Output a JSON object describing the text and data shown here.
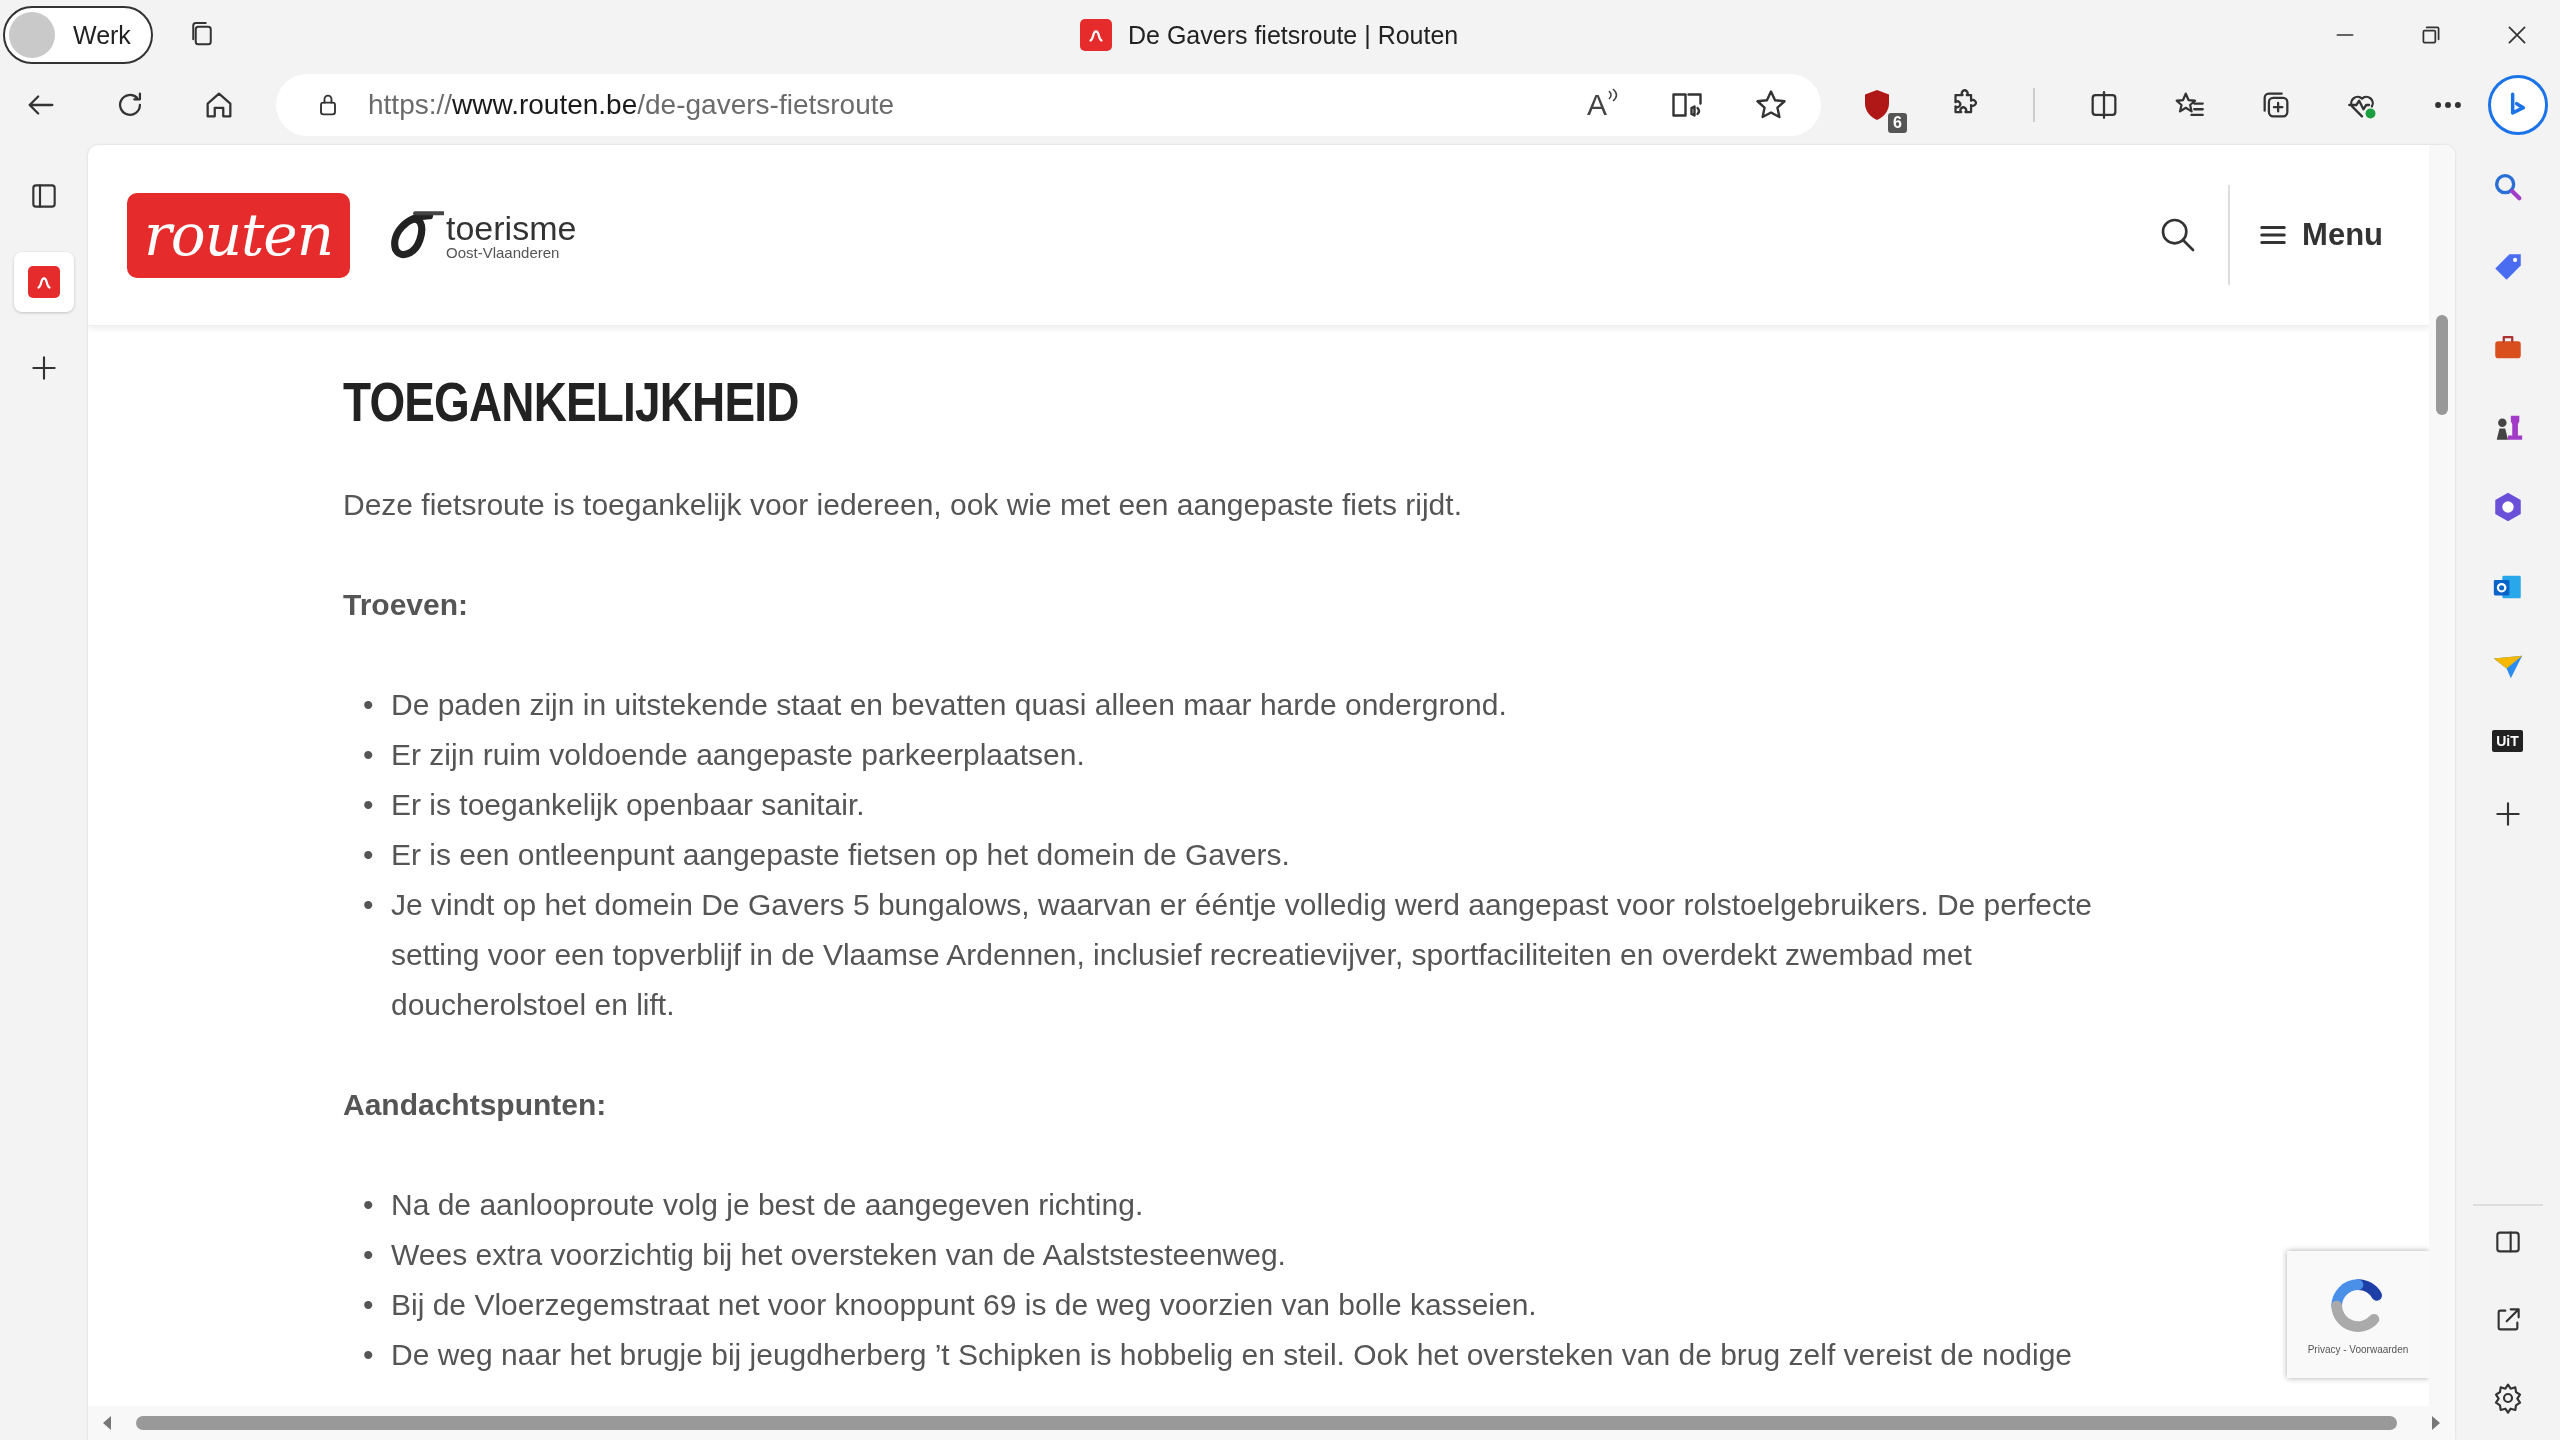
{
  "browser": {
    "profile": "Werk",
    "tab_title": "De Gavers fietsroute | Routen",
    "url": "https://**www.routen.be**/de-gavers-fietsroute",
    "read_aloud_glyph": "A",
    "extension_badge": "6",
    "sidebar_app_label": "UiT"
  },
  "header": {
    "logo": "routen",
    "partner_name": "toerisme",
    "partner_region": "Oost-Vlaanderen",
    "menu_label": "Menu"
  },
  "article": {
    "heading": "TOEGANKELIJKHEID",
    "intro": "Deze fietsroute is toegankelijk voor iedereen, ook wie met een aangepaste fiets rijdt.",
    "groups": [
      {
        "title": "Troeven:",
        "items": [
          {
            "marker": "•",
            "text": "De paden zijn in uitstekende staat en bevatten quasi alleen maar harde ondergrond."
          },
          {
            "marker": "•",
            "text": "Er zijn ruim voldoende aangepaste parkeerplaatsen."
          },
          {
            "marker": "•",
            "text": "Er is toegankelijk openbaar sanitair."
          },
          {
            "marker": "•",
            "text": "Er is een ontleenpunt aangepaste fietsen op het domein de Gavers."
          },
          {
            "marker": "•",
            "text": "Je vindt op het domein De Gavers 5 bungalows, waarvan er ééntje volledig werd aangepast voor rolstoelgebruikers. De perfecte setting voor een topverblijf in de Vlaamse Ardennen, inclusief recreatievijver, sportfaciliteiten en overdekt zwembad met doucherolstoel en lift."
          }
        ]
      },
      {
        "title": "Aandachtspunten:",
        "items": [
          {
            "marker": "•",
            "text": "Na de aanlooproute volg je best de aangegeven richting."
          },
          {
            "marker": "•",
            "text": "Wees extra voorzichtig bij het oversteken van de Aalststesteenweg."
          },
          {
            "marker": "•",
            "text": "Bij de Vloerzegemstraat net voor knooppunt 69 is de weg voorzien van bolle kasseien."
          },
          {
            "marker": "•",
            "text": "De weg naar het brugje bij jeugdherberg ’t Schipken is hobbelig en steil. Ook het oversteken van de brug zelf vereist de nodige"
          }
        ]
      }
    ]
  },
  "recaptcha": {
    "links": "Privacy - Voorwaarden"
  }
}
